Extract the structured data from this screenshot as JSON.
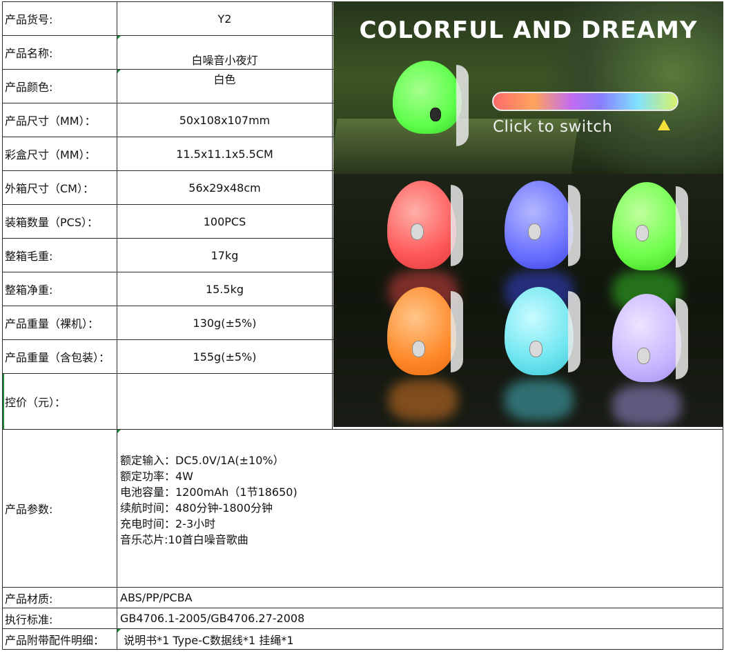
{
  "spec_rows": [
    {
      "label": "产品货号:",
      "value": "Y2"
    },
    {
      "label": "产品名称:",
      "value": "白噪音小夜灯"
    },
    {
      "label": "产品颜色:",
      "value": "白色"
    },
    {
      "label": "产品尺寸（MM）：",
      "value": "50x108x107mm"
    },
    {
      "label": "彩盒尺寸（MM）：",
      "value": "11.5x11.1x5.5CM"
    },
    {
      "label": "外箱尺寸（CM）：",
      "value": "56x29x48cm"
    },
    {
      "label": "装箱数量（PCS）：",
      "value": "100PCS"
    },
    {
      "label": "整箱毛重:",
      "value": "17kg"
    },
    {
      "label": "整箱净重:",
      "value": "15.5kg"
    },
    {
      "label": "产品重量（裸机）：",
      "value": "130g(±5%)"
    },
    {
      "label": "产品重量（含包装）：",
      "value": "155g(±5%)"
    },
    {
      "label": "控价（元）：",
      "value": ""
    }
  ],
  "params": {
    "label": "产品参数:",
    "lines": [
      "额定输入：DC5.0V/1A(±10%）",
      "额定功率：4W",
      "电池容量：1200mAh（1节18650)",
      "续航时间：480分钟-1800分钟",
      "充电时间：2-3小时",
      "音乐芯片:10首白噪音歌曲"
    ]
  },
  "bottom_rows": [
    {
      "label": "产品材质:",
      "value": "ABS/PP/PCBA"
    },
    {
      "label": "执行标准:",
      "value": "GB4706.1-2005/GB4706.27-2008"
    },
    {
      "label": "产品附带配件明细：",
      "value": " 说明书*1 Type-C数据线*1 挂绳*1"
    }
  ],
  "product_image": {
    "headline": "COLORFUL AND DREAMY",
    "switch_text": "Click to switch",
    "lamp_colors": [
      "#5dff4a",
      "#ff5a5a",
      "#6c72ff",
      "#6dff4a",
      "#ff8a2a",
      "#6fe6f0",
      "#c9b6ff"
    ]
  }
}
